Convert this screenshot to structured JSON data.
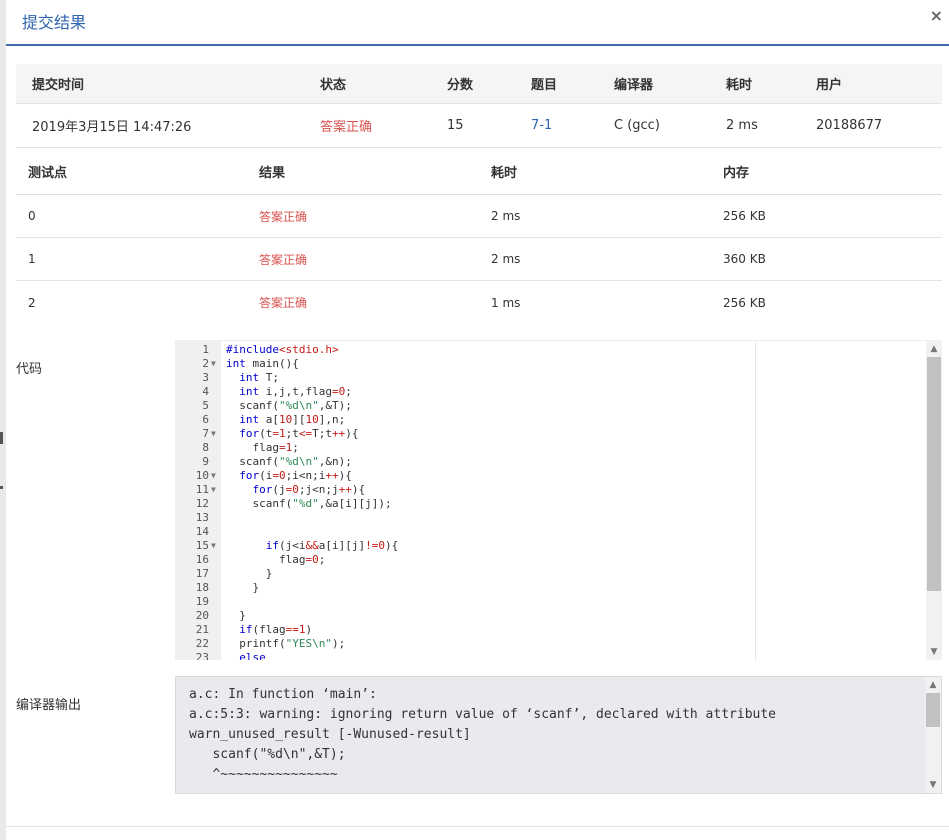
{
  "modal": {
    "title": "提交结果",
    "close_icon": "×"
  },
  "submission": {
    "headers": [
      "提交时间",
      "状态",
      "分数",
      "题目",
      "编译器",
      "耗时",
      "用户"
    ],
    "row": {
      "time": "2019年3月15日 14:47:26",
      "status": "答案正确",
      "score": "15",
      "problem": "7-1",
      "compiler": "C (gcc)",
      "elapsed": "2 ms",
      "user": "20188677"
    }
  },
  "cases": {
    "headers": [
      "测试点",
      "结果",
      "耗时",
      "内存"
    ],
    "rows": [
      {
        "id": "0",
        "result": "答案正确",
        "time": "2 ms",
        "memory": "256 KB"
      },
      {
        "id": "1",
        "result": "答案正确",
        "time": "2 ms",
        "memory": "360 KB"
      },
      {
        "id": "2",
        "result": "答案正确",
        "time": "1 ms",
        "memory": "256 KB"
      }
    ]
  },
  "code": {
    "label": "代码",
    "lines": [
      "#include<stdio.h>",
      "int main(){",
      "  int T;",
      "  int i,j,t,flag=0;",
      "  scanf(\"%d\\n\",&T);",
      "  int a[10][10],n;",
      "  for(t=1;t<=T;t++){",
      "    flag=1;",
      "  scanf(\"%d\\n\",&n);",
      "  for(i=0;i<n;i++){",
      "    for(j=0;j<n;j++){",
      "    scanf(\"%d\",&a[i][j]);",
      "",
      "",
      "      if(j<i&&a[i][j]!=0){",
      "        flag=0;",
      "      }",
      "    }",
      "",
      "  }",
      "  if(flag==1)",
      "  printf(\"YES\\n\");",
      "  else"
    ],
    "fold_lines": [
      2,
      7,
      10,
      11,
      15
    ]
  },
  "compiler_output": {
    "label": "编译器输出",
    "text": "a.c: In function ‘main’:\na.c:5:3: warning: ignoring return value of ‘scanf’, declared with attribute\nwarn_unused_result [-Wunused-result]\n   scanf(\"%d\\n\",&T);\n   ^~~~~~~~~~~~~~~~\n"
  }
}
